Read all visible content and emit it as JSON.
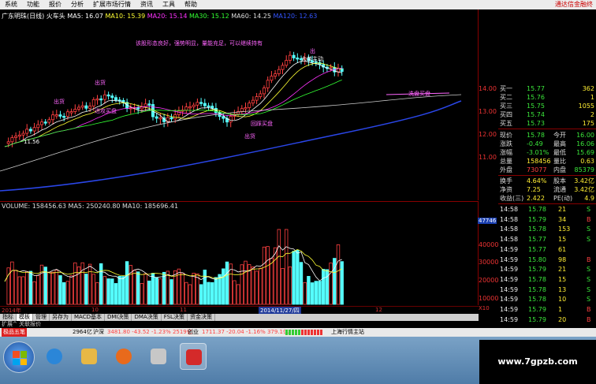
{
  "menu": {
    "items": [
      "系统",
      "功能",
      "报价",
      "分析",
      "扩展市场行情",
      "资讯",
      "工具",
      "帮助"
    ],
    "right_text": "通达信金融终"
  },
  "kline": {
    "indicator_line": [
      {
        "t": "广东明珠(日线)",
        "c": "#ffffff"
      },
      {
        "t": "火车头",
        "c": "#ffffff"
      },
      {
        "t": "MA5: 16.07",
        "c": "#ffffff"
      },
      {
        "t": "MA10: 15.39",
        "c": "#ffff33"
      },
      {
        "t": "MA20: 15.14",
        "c": "#ff33ff"
      },
      {
        "t": "MA30: 15.12",
        "c": "#33ff33"
      },
      {
        "t": "MA60: 14.25",
        "c": "#dddddd"
      },
      {
        "t": "MA120: 12.63",
        "c": "#3355ff"
      }
    ],
    "price_axis": [
      "14.00",
      "13.00",
      "12.00",
      "11.00"
    ],
    "low_label": "11.56",
    "annotations": {
      "a1": "该股形态良好，强势明显，量能充足，可以继续持有",
      "a2": "出货",
      "a3": "出货",
      "a4": "进攻买盘",
      "a5": "出货",
      "a6": "出",
      "a7": "回踩买盘",
      "a8": "大单主动",
      "a9": "洗盘买盘"
    }
  },
  "volume": {
    "line": "VOLUME: 158456.63  MA5: 250240.80  MA10: 185696.41",
    "axis": [
      "40000",
      "30000",
      "20000",
      "10000"
    ],
    "marker": "47746",
    "unit": "X10"
  },
  "date_axis": {
    "labels": [
      "2014年",
      "10",
      "11",
      "12"
    ],
    "selected": "2014/11/27/四"
  },
  "tabs": [
    "指标",
    "模板",
    "管理",
    "另存为",
    "MACD基本",
    "DMI决策",
    "DMA决策",
    "FSL决策",
    "资金决策"
  ],
  "tabs2": "扩展^  关联报价",
  "quote": {
    "orders": [
      {
        "label": "买一",
        "price": "15.77",
        "vol": "362"
      },
      {
        "label": "买二",
        "price": "15.76",
        "vol": "1"
      },
      {
        "label": "买三",
        "price": "15.75",
        "vol": "1055"
      },
      {
        "label": "买四",
        "price": "15.74",
        "vol": "2"
      },
      {
        "label": "买五",
        "price": "15.73",
        "vol": "175"
      }
    ],
    "stats": [
      {
        "l1": "现价",
        "v1": "15.78",
        "l2": "今开",
        "v2": "16.00"
      },
      {
        "l1": "涨跌",
        "v1": "-0.49",
        "l2": "最高",
        "v2": "16.06"
      },
      {
        "l1": "涨幅",
        "v1": "-3.01%",
        "l2": "最低",
        "v2": "15.69"
      },
      {
        "l1": "总量",
        "v1": "158456",
        "l2": "量比",
        "v2": "0.63"
      },
      {
        "l1": "外盘",
        "v1": "73077",
        "l2": "内盘",
        "v2": "85379"
      },
      {
        "l1": "换手",
        "v1": "4.64%",
        "l2": "股本",
        "v2": "3.42亿"
      },
      {
        "l1": "净资",
        "v1": "7.25",
        "l2": "流通",
        "v2": "3.42亿"
      },
      {
        "l1": "收益(三)",
        "v1": "2.422",
        "l2": "PE(动)",
        "v2": "4.9"
      }
    ],
    "ticks": [
      {
        "time": "14:58",
        "price": "15.78",
        "vol": "21",
        "bs": "S"
      },
      {
        "time": "14:58",
        "price": "15.79",
        "vol": "34",
        "bs": "B"
      },
      {
        "time": "14:58",
        "price": "15.78",
        "vol": "153",
        "bs": "S"
      },
      {
        "time": "14:58",
        "price": "15.77",
        "vol": "15",
        "bs": "S"
      },
      {
        "time": "14:59",
        "price": "15.77",
        "vol": "61",
        "bs": ""
      },
      {
        "time": "14:59",
        "price": "15.80",
        "vol": "98",
        "bs": "B"
      },
      {
        "time": "14:59",
        "price": "15.79",
        "vol": "21",
        "bs": "S"
      },
      {
        "time": "14:59",
        "price": "15.78",
        "vol": "15",
        "bs": "S"
      },
      {
        "time": "14:59",
        "price": "15.78",
        "vol": "13",
        "bs": "S"
      },
      {
        "time": "14:59",
        "price": "15.78",
        "vol": "10",
        "bs": "S"
      },
      {
        "time": "14:59",
        "price": "15.79",
        "vol": "1",
        "bs": "B"
      },
      {
        "time": "14:59",
        "price": "15.79",
        "vol": "20",
        "bs": "B"
      }
    ]
  },
  "status": {
    "logo": "极品五笔",
    "seg1": "2964亿",
    "sh_label": "沪深",
    "sh": "3481.80  -43.52  -1.23%  2519亿",
    "cy_label": "创业",
    "cy": "1711.37  -20.04  -1.16%  379.1亿",
    "link": "上海行情主站"
  },
  "watermark": "www.7gpzb.com",
  "colors": {
    "up": "#ff4040",
    "down": "#55ffff",
    "ma120": "#2a46e8",
    "accent_red": "#ff4040"
  }
}
